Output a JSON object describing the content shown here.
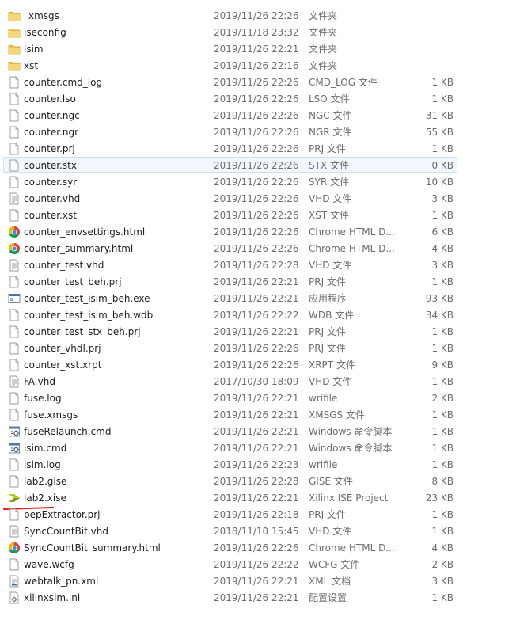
{
  "colors": {
    "folder": "#f0c24b",
    "selection_bg": "#f2f7fd",
    "selection_border": "#cfe1f6",
    "annotation": "#e02424",
    "meta_text": "#6d6d6d"
  },
  "selected_file": "counter.stx",
  "annotated_file": "lab2.xise",
  "files": [
    {
      "name": "_xmsgs",
      "date": "2019/11/26 22:26",
      "type": "文件夹",
      "size": "",
      "icon": "folder-icon"
    },
    {
      "name": "iseconfig",
      "date": "2019/11/18 23:32",
      "type": "文件夹",
      "size": "",
      "icon": "folder-icon"
    },
    {
      "name": "isim",
      "date": "2019/11/26 22:21",
      "type": "文件夹",
      "size": "",
      "icon": "folder-icon"
    },
    {
      "name": "xst",
      "date": "2019/11/26 22:16",
      "type": "文件夹",
      "size": "",
      "icon": "folder-icon"
    },
    {
      "name": "counter.cmd_log",
      "date": "2019/11/26 22:26",
      "type": "CMD_LOG 文件",
      "size": "1 KB",
      "icon": "file-icon"
    },
    {
      "name": "counter.lso",
      "date": "2019/11/26 22:26",
      "type": "LSO 文件",
      "size": "1 KB",
      "icon": "file-icon"
    },
    {
      "name": "counter.ngc",
      "date": "2019/11/26 22:26",
      "type": "NGC 文件",
      "size": "31 KB",
      "icon": "file-icon"
    },
    {
      "name": "counter.ngr",
      "date": "2019/11/26 22:26",
      "type": "NGR 文件",
      "size": "55 KB",
      "icon": "file-icon"
    },
    {
      "name": "counter.prj",
      "date": "2019/11/26 22:26",
      "type": "PRJ 文件",
      "size": "1 KB",
      "icon": "file-icon"
    },
    {
      "name": "counter.stx",
      "date": "2019/11/26 22:26",
      "type": "STX 文件",
      "size": "0 KB",
      "icon": "file-icon"
    },
    {
      "name": "counter.syr",
      "date": "2019/11/26 22:26",
      "type": "SYR 文件",
      "size": "10 KB",
      "icon": "file-icon"
    },
    {
      "name": "counter.vhd",
      "date": "2019/11/26 22:26",
      "type": "VHD 文件",
      "size": "3 KB",
      "icon": "text-file-icon"
    },
    {
      "name": "counter.xst",
      "date": "2019/11/26 22:26",
      "type": "XST 文件",
      "size": "1 KB",
      "icon": "file-icon"
    },
    {
      "name": "counter_envsettings.html",
      "date": "2019/11/26 22:26",
      "type": "Chrome HTML D...",
      "size": "6 KB",
      "icon": "chrome-icon"
    },
    {
      "name": "counter_summary.html",
      "date": "2019/11/26 22:26",
      "type": "Chrome HTML D...",
      "size": "4 KB",
      "icon": "chrome-icon"
    },
    {
      "name": "counter_test.vhd",
      "date": "2019/11/26 22:28",
      "type": "VHD 文件",
      "size": "3 KB",
      "icon": "text-file-icon"
    },
    {
      "name": "counter_test_beh.prj",
      "date": "2019/11/26 22:21",
      "type": "PRJ 文件",
      "size": "1 KB",
      "icon": "file-icon"
    },
    {
      "name": "counter_test_isim_beh.exe",
      "date": "2019/11/26 22:21",
      "type": "应用程序",
      "size": "93 KB",
      "icon": "exe-icon"
    },
    {
      "name": "counter_test_isim_beh.wdb",
      "date": "2019/11/26 22:22",
      "type": "WDB 文件",
      "size": "34 KB",
      "icon": "file-icon"
    },
    {
      "name": "counter_test_stx_beh.prj",
      "date": "2019/11/26 22:21",
      "type": "PRJ 文件",
      "size": "1 KB",
      "icon": "file-icon"
    },
    {
      "name": "counter_vhdl.prj",
      "date": "2019/11/26 22:26",
      "type": "PRJ 文件",
      "size": "1 KB",
      "icon": "file-icon"
    },
    {
      "name": "counter_xst.xrpt",
      "date": "2019/11/26 22:26",
      "type": "XRPT 文件",
      "size": "9 KB",
      "icon": "file-icon"
    },
    {
      "name": "FA.vhd",
      "date": "2017/10/30 18:09",
      "type": "VHD 文件",
      "size": "1 KB",
      "icon": "text-file-icon"
    },
    {
      "name": "fuse.log",
      "date": "2019/11/26 22:21",
      "type": "wrifile",
      "size": "2 KB",
      "icon": "file-icon"
    },
    {
      "name": "fuse.xmsgs",
      "date": "2019/11/26 22:21",
      "type": "XMSGS 文件",
      "size": "1 KB",
      "icon": "file-icon"
    },
    {
      "name": "fuseRelaunch.cmd",
      "date": "2019/11/26 22:21",
      "type": "Windows 命令脚本",
      "size": "1 KB",
      "icon": "cmd-script-icon"
    },
    {
      "name": "isim.cmd",
      "date": "2019/11/26 22:21",
      "type": "Windows 命令脚本",
      "size": "1 KB",
      "icon": "cmd-script-icon"
    },
    {
      "name": "isim.log",
      "date": "2019/11/26 22:23",
      "type": "wrifile",
      "size": "1 KB",
      "icon": "file-icon"
    },
    {
      "name": "lab2.gise",
      "date": "2019/11/26 22:28",
      "type": "GISE 文件",
      "size": "8 KB",
      "icon": "file-icon"
    },
    {
      "name": "lab2.xise",
      "date": "2019/11/26 22:21",
      "type": "Xilinx ISE Project",
      "size": "23 KB",
      "icon": "xilinx-ise-icon"
    },
    {
      "name": "pepExtractor.prj",
      "date": "2019/11/26 22:18",
      "type": "PRJ 文件",
      "size": "1 KB",
      "icon": "file-icon"
    },
    {
      "name": "SyncCountBit.vhd",
      "date": "2018/11/10 15:45",
      "type": "VHD 文件",
      "size": "1 KB",
      "icon": "text-file-icon"
    },
    {
      "name": "SyncCountBit_summary.html",
      "date": "2019/11/26 22:26",
      "type": "Chrome HTML D...",
      "size": "4 KB",
      "icon": "chrome-icon"
    },
    {
      "name": "wave.wcfg",
      "date": "2019/11/26 22:22",
      "type": "WCFG 文件",
      "size": "2 KB",
      "icon": "file-icon"
    },
    {
      "name": "webtalk_pn.xml",
      "date": "2019/11/26 22:21",
      "type": "XML 文档",
      "size": "3 KB",
      "icon": "xml-file-icon"
    },
    {
      "name": "xilinxsim.ini",
      "date": "2019/11/26 22:21",
      "type": "配置设置",
      "size": "1 KB",
      "icon": "settings-file-icon"
    }
  ]
}
